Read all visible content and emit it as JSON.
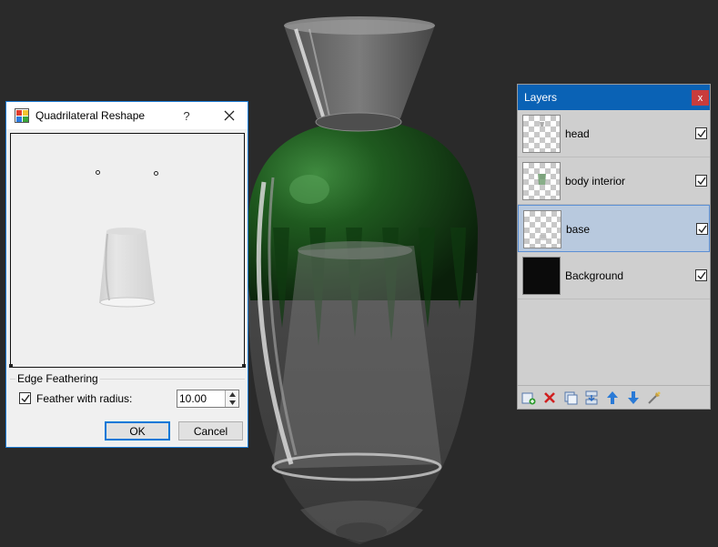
{
  "dialog": {
    "title": "Quadrilateral Reshape",
    "help_label": "?",
    "group_label": "Edge Feathering",
    "feather_label": "Feather with radius:",
    "feather_checked": true,
    "radius_value": "10.00",
    "ok_label": "OK",
    "cancel_label": "Cancel"
  },
  "layers_panel": {
    "title": "Layers",
    "close_label": "x",
    "layers": [
      {
        "name": "head",
        "visible": true,
        "selected": false
      },
      {
        "name": "body interior",
        "visible": true,
        "selected": false
      },
      {
        "name": "base",
        "visible": true,
        "selected": true
      },
      {
        "name": "Background",
        "visible": true,
        "selected": false
      }
    ],
    "tools": [
      "add-layer-icon",
      "delete-layer-icon",
      "duplicate-layer-icon",
      "merge-down-icon",
      "move-up-icon",
      "move-down-icon",
      "properties-icon"
    ]
  },
  "colors": {
    "accent": "#0a62b5",
    "selection": "#b8c9de",
    "vase_green": "#1e5a1e"
  }
}
